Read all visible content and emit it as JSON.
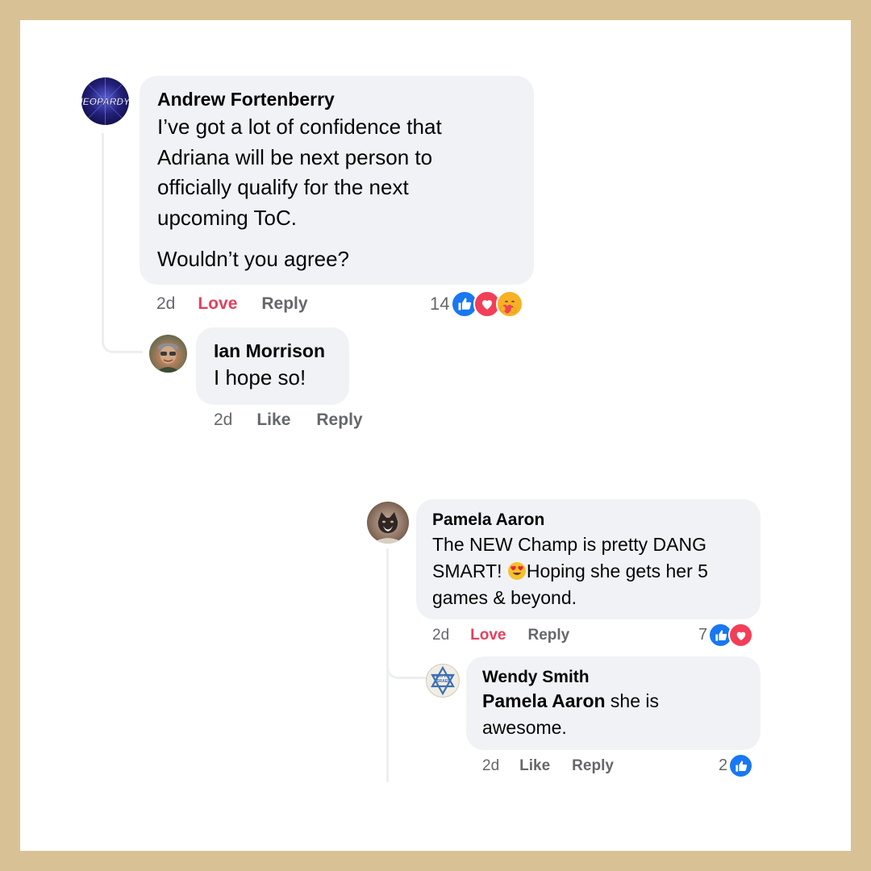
{
  "thread1": {
    "comment": {
      "author": "Andrew Fortenberry",
      "avatar_icon": "jeopardy-logo-icon",
      "avatar_text": "JEOPARDY!",
      "paragraph1": [
        "I’ve got a lot of confidence that",
        "Adriana will be next person to",
        "officially qualify for the next",
        "upcoming ToC."
      ],
      "paragraph2": "Wouldn’t you agree?",
      "time": "2d",
      "love_label": "Love",
      "reply_label": "Reply",
      "reaction_count": "14",
      "reaction_icons": [
        "like-icon",
        "love-icon",
        "care-icon"
      ]
    },
    "reply": {
      "author": "Ian Morrison",
      "avatar_icon": "profile-photo-icon",
      "text": "I hope so!",
      "time": "2d",
      "like_label": "Like",
      "reply_label": "Reply"
    }
  },
  "thread2": {
    "comment": {
      "author": "Pamela Aaron",
      "avatar_icon": "cat-photo-icon",
      "line1": "The NEW Champ is pretty DANG",
      "line2_before": "SMART! ",
      "emoji": "heart-eyes-emoji",
      "line2_after": "Hoping she gets her 5",
      "line3": "games & beyond.",
      "time": "2d",
      "love_label": "Love",
      "reply_label": "Reply",
      "reaction_count": "7",
      "reaction_icons": [
        "like-icon",
        "love-icon"
      ]
    },
    "reply": {
      "author": "Wendy Smith",
      "avatar_icon": "star-of-david-badge-icon",
      "avatar_text": [
        "PRAY FOR",
        "ISRAEL"
      ],
      "mention": "Pamela Aaron",
      "text_after_mention": " she is",
      "text_line2": "awesome.",
      "time": "2d",
      "like_label": "Like",
      "reply_label": "Reply",
      "reaction_count": "2",
      "reaction_icons": [
        "like-icon"
      ]
    }
  },
  "colors": {
    "frame": "#d8c195",
    "bubble": "#f0f2f5",
    "love": "#e4405f",
    "like": "#1877f2",
    "meta": "#65676b"
  }
}
